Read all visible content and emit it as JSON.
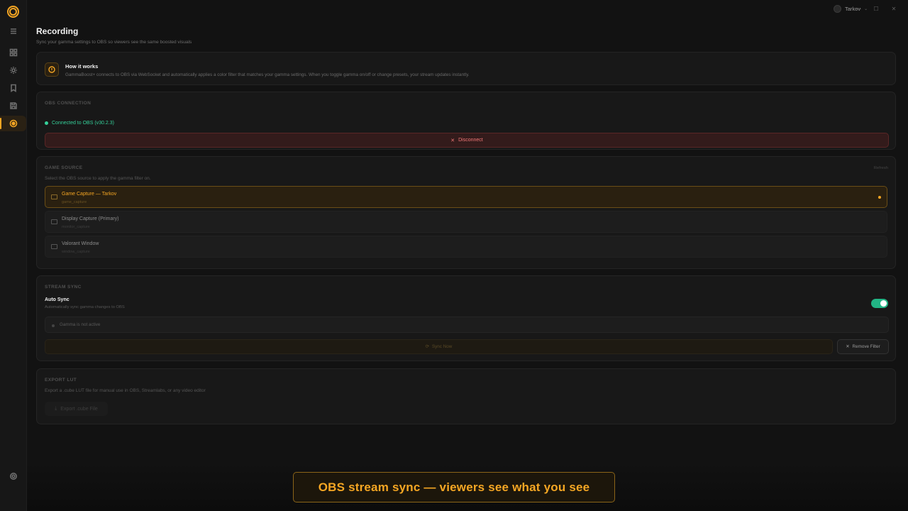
{
  "profile": {
    "name": "Tarkov"
  },
  "page": {
    "title": "Recording",
    "subtitle": "Sync your gamma settings to OBS so viewers see the same boosted visuals"
  },
  "how_it_works": {
    "title": "How it works",
    "text": "GammaBoost+ connects to OBS via WebSocket and automatically applies a color filter that matches your gamma settings. When you toggle gamma on/off or change presets, your stream updates instantly."
  },
  "obs_connection": {
    "label": "OBS CONNECTION",
    "status": "Connected to OBS (v30.2.3)",
    "disconnect_label": "Disconnect"
  },
  "game_source": {
    "label": "GAME SOURCE",
    "refresh_label": "Refresh",
    "hint": "Select the OBS source to apply the gamma filter on.",
    "sources": [
      {
        "name": "Game Capture — Tarkov",
        "type": "game_capture",
        "selected": true
      },
      {
        "name": "Display Capture (Primary)",
        "type": "monitor_capture",
        "selected": false
      },
      {
        "name": "Valorant Window",
        "type": "window_capture",
        "selected": false
      }
    ]
  },
  "stream_sync": {
    "label": "STREAM SYNC",
    "auto_sync_title": "Auto Sync",
    "auto_sync_sub": "Automatically sync gamma changes to OBS",
    "auto_sync_on": true,
    "gamma_status": "Gamma is not active",
    "sync_now_label": "Sync Now",
    "remove_filter_label": "Remove Filter"
  },
  "export_lut": {
    "label": "EXPORT LUT",
    "hint": "Export a .cube LUT file for manual use in OBS, Streamlabs, or any video editor",
    "button_label": "Export .cube File"
  },
  "banner": {
    "text": "OBS stream sync — viewers see what you see"
  },
  "colors": {
    "accent": "#f5a623",
    "success": "#35d09a",
    "danger": "#f27777",
    "toggle_on": "#22b585"
  }
}
